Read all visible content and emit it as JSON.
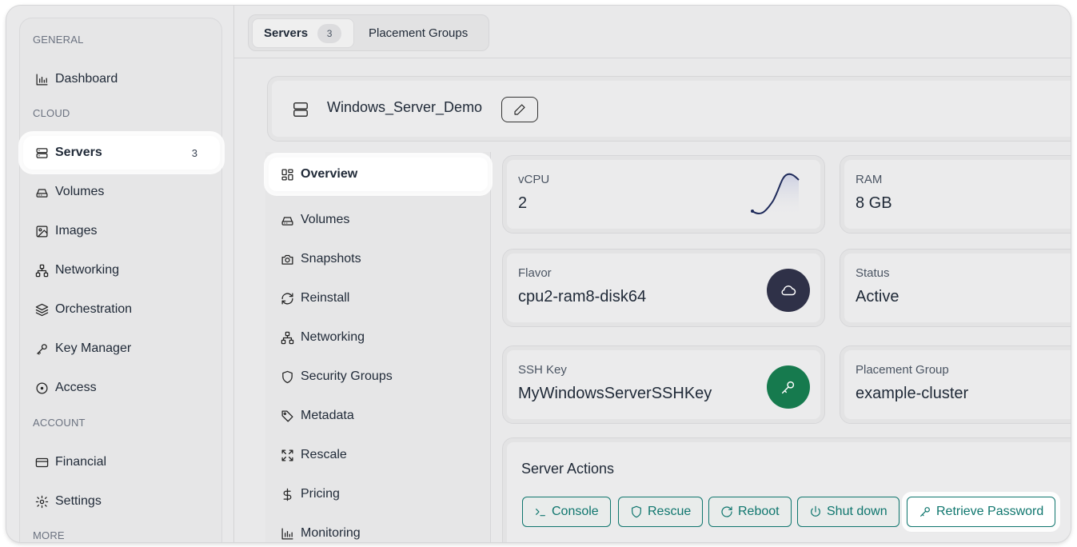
{
  "sidebar": {
    "sections": {
      "general": "GENERAL",
      "cloud": "CLOUD",
      "account": "ACCOUNT",
      "more": "MORE"
    },
    "items": {
      "dashboard": "Dashboard",
      "servers": "Servers",
      "servers_count": "3",
      "volumes": "Volumes",
      "images": "Images",
      "networking": "Networking",
      "orchestration": "Orchestration",
      "key_manager": "Key Manager",
      "access": "Access",
      "financial": "Financial",
      "settings": "Settings"
    }
  },
  "tabs": {
    "servers": "Servers",
    "servers_count": "3",
    "placement_groups": "Placement Groups"
  },
  "server": {
    "name": "Windows_Server_Demo"
  },
  "subnav": {
    "overview": "Overview",
    "volumes": "Volumes",
    "snapshots": "Snapshots",
    "reinstall": "Reinstall",
    "networking": "Networking",
    "security_groups": "Security Groups",
    "metadata": "Metadata",
    "rescale": "Rescale",
    "pricing": "Pricing",
    "monitoring": "Monitoring"
  },
  "stats": {
    "vcpu": {
      "label": "vCPU",
      "value": "2"
    },
    "ram": {
      "label": "RAM",
      "value": "8 GB"
    },
    "flavor": {
      "label": "Flavor",
      "value": "cpu2-ram8-disk64",
      "icon": "cloud-icon",
      "color": "#2f3148"
    },
    "status": {
      "label": "Status",
      "value": "Active"
    },
    "ssh_key": {
      "label": "SSH Key",
      "value": "MyWindowsServerSSHKey",
      "icon": "key-icon",
      "color": "#167a4e"
    },
    "placement_group": {
      "label": "Placement Group",
      "value": "example-cluster"
    }
  },
  "actions": {
    "title": "Server Actions",
    "console": "Console",
    "rescue": "Rescue",
    "reboot": "Reboot",
    "shut_down": "Shut down",
    "retrieve_password": "Retrieve Password"
  },
  "colors": {
    "accent": "#0f766e",
    "background": "#e9e9ea"
  }
}
